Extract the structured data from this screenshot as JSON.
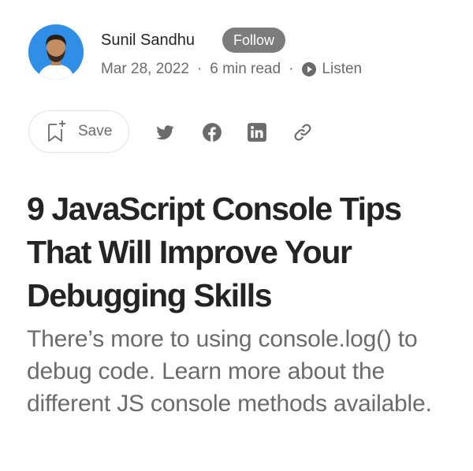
{
  "author": {
    "name": "Sunil Sandhu",
    "follow_label": "Follow",
    "date": "Mar 28, 2022",
    "separator": "·",
    "read_time": "6 min read",
    "listen_label": "Listen"
  },
  "actions": {
    "save_label": "Save",
    "share_icons": [
      "twitter-icon",
      "facebook-icon",
      "linkedin-icon",
      "link-icon"
    ]
  },
  "article": {
    "title": "9 JavaScript Console Tips That Will Improve Your Debugging Skills",
    "subtitle": "There’s more to using console.log() to debug code. Learn more about the different JS console methods available."
  },
  "colors": {
    "text_primary": "#242424",
    "text_secondary": "#6b6b6b",
    "follow_bg": "#7c7c7c",
    "avatar_bg": "#2f8ee6",
    "icon_gray": "#6b6b6b"
  }
}
